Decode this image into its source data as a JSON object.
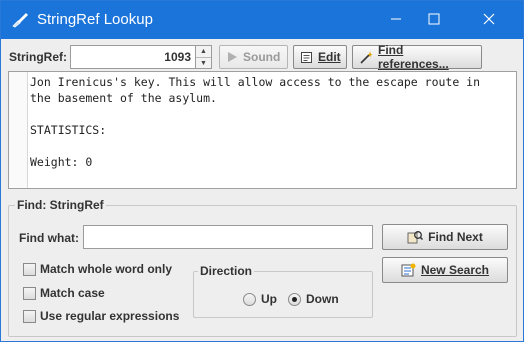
{
  "window": {
    "title": "StringRef Lookup",
    "title_bar_color": "#1b74d9",
    "controls": [
      "minimize-icon",
      "maximize-icon",
      "close-icon"
    ]
  },
  "top_row": {
    "strref_label": "StringRef:",
    "strref_value": "1093",
    "spinner_icons": [
      "spin-up-icon",
      "spin-down-icon"
    ],
    "sound_button": {
      "label": "Sound",
      "enabled": false,
      "icon": "play-icon"
    },
    "edit_button": {
      "label": "Edit",
      "mnemonic": "E",
      "icon": "edit-icon"
    },
    "find_refs_button": {
      "label": "Find references...",
      "mnemonic": "F",
      "icon": "wand-icon"
    }
  },
  "text_area": {
    "lines": [
      "Jon Irenicus's key. This will allow access to the escape route in",
      "the basement of the asylum.",
      "",
      "STATISTICS:",
      "",
      "Weight: 0"
    ]
  },
  "find": {
    "group_title": "Find: StringRef",
    "find_what_label": "Find what:",
    "find_what_value": "",
    "find_next_button": {
      "label": "Find Next",
      "icon": "find-next-icon"
    },
    "new_search_button": {
      "label": "New Search",
      "icon": "new-search-icon"
    },
    "options": [
      {
        "label": "Match whole word only",
        "checked": false
      },
      {
        "label": "Match case",
        "checked": false
      },
      {
        "label": "Use regular expressions",
        "checked": false
      }
    ],
    "direction": {
      "title": "Direction",
      "options": [
        {
          "label": "Up",
          "selected": false
        },
        {
          "label": "Down",
          "selected": true
        }
      ]
    }
  }
}
